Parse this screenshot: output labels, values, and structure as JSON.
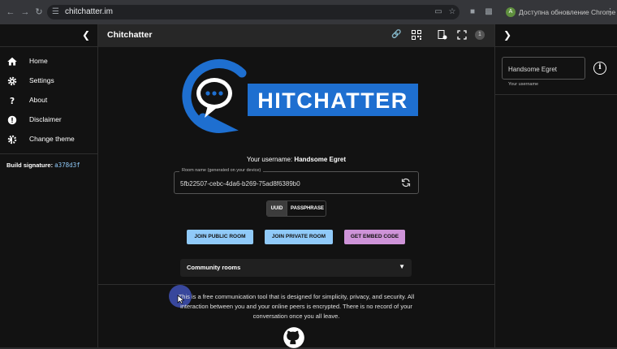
{
  "browser": {
    "url": "chitchatter.im",
    "profile_initial": "A",
    "update_label": "Доступна обновление Chrome"
  },
  "left_sidebar": {
    "items": [
      {
        "label": "Home",
        "icon": "home-icon"
      },
      {
        "label": "Settings",
        "icon": "gear-icon"
      },
      {
        "label": "About",
        "icon": "question-icon"
      },
      {
        "label": "Disclaimer",
        "icon": "alert-icon"
      },
      {
        "label": "Change theme",
        "icon": "theme-icon"
      }
    ],
    "build_label": "Build signature:",
    "build_hash": "a378d3f"
  },
  "topbar": {
    "title": "Chitchatter",
    "peer_count": "1"
  },
  "logo": {
    "text": "HITCHATTER"
  },
  "main": {
    "username_prefix": "Your username:",
    "username": "Handsome Egret",
    "room_field_label": "Room name (generated on your device)",
    "room_field_value": "5fb22507-cebc-4da6-b269-75ad8f6389b0",
    "toggle": {
      "uuid": "UUID",
      "passphrase": "PASSPHRASE",
      "selected": "UUID"
    },
    "buttons": {
      "join_public": "JOIN PUBLIC ROOM",
      "join_private": "JOIN PRIVATE ROOM",
      "embed": "GET EMBED CODE"
    },
    "community_rooms": "Community rooms",
    "about_text": "This is a free communication tool that is designed for simplicity, privacy, and security. All interaction between you and your online peers is encrypted. There is no record of your conversation once you all leave."
  },
  "right_sidebar": {
    "username_value": "Handsome Egret",
    "username_help": "Your username"
  },
  "colors": {
    "accent_blue": "#90caf9",
    "accent_purple": "#ce93d8",
    "logo_blue": "#1e6fd0",
    "background": "#121212"
  }
}
